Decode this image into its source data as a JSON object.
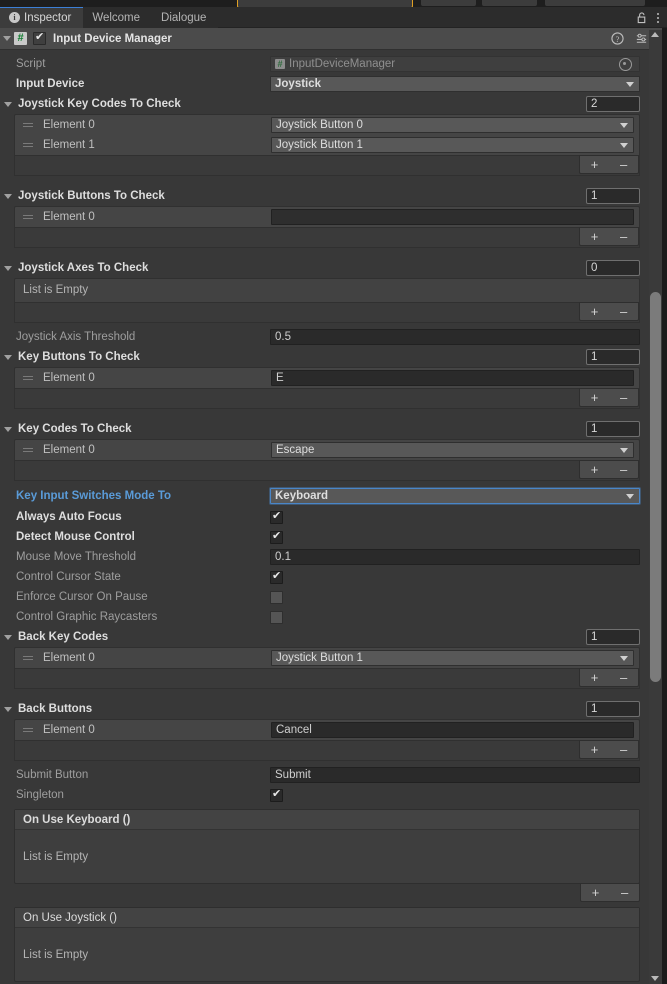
{
  "window": {
    "tabs": [
      {
        "label": "Inspector",
        "icon": "info-icon",
        "active": true
      },
      {
        "label": "Welcome",
        "icon": "",
        "active": false
      },
      {
        "label": "Dialogue",
        "icon": "",
        "active": false
      }
    ],
    "lock_icon": "lock-open-icon",
    "menu_icon": "kebab-menu-icon"
  },
  "component": {
    "enabled": true,
    "title": "Input Device Manager",
    "script_icon": "csharp-script-icon",
    "help_icon": "help-icon",
    "preset_icon": "preset-icon",
    "menu_icon": "kebab-menu-icon"
  },
  "fields": {
    "script": {
      "label": "Script",
      "value": "InputDeviceManager",
      "icon": "csharp-script-icon",
      "picker": "object-picker-icon"
    },
    "input_device": {
      "label": "Input Device",
      "value": "Joystick"
    },
    "joystick_key_codes": {
      "label": "Joystick Key Codes To Check",
      "count": "2",
      "elements": [
        {
          "label": "Element 0",
          "value": "Joystick Button 0"
        },
        {
          "label": "Element 1",
          "value": "Joystick Button 1"
        }
      ]
    },
    "joystick_buttons": {
      "label": "Joystick Buttons To Check",
      "count": "1",
      "elements": [
        {
          "label": "Element 0",
          "value": ""
        }
      ]
    },
    "joystick_axes": {
      "label": "Joystick Axes To Check",
      "count": "0",
      "empty_text": "List is Empty"
    },
    "joystick_axis_threshold": {
      "label": "Joystick Axis Threshold",
      "value": "0.5"
    },
    "key_buttons": {
      "label": "Key Buttons To Check",
      "count": "1",
      "elements": [
        {
          "label": "Element 0",
          "value": "E"
        }
      ]
    },
    "key_codes": {
      "label": "Key Codes To Check",
      "count": "1",
      "elements": [
        {
          "label": "Element 0",
          "value": "Escape"
        }
      ]
    },
    "key_input_switches_mode_to": {
      "label": "Key Input Switches Mode To",
      "value": "Keyboard"
    },
    "always_auto_focus": {
      "label": "Always Auto Focus",
      "checked": true
    },
    "detect_mouse_control": {
      "label": "Detect Mouse Control",
      "checked": true
    },
    "mouse_move_threshold": {
      "label": "Mouse Move Threshold",
      "value": "0.1"
    },
    "control_cursor_state": {
      "label": "Control Cursor State",
      "checked": true
    },
    "enforce_cursor_on_pause": {
      "label": "Enforce Cursor On Pause",
      "checked": false
    },
    "control_graphic_raycasters": {
      "label": "Control Graphic Raycasters",
      "checked": false
    },
    "back_key_codes": {
      "label": "Back Key Codes",
      "count": "1",
      "elements": [
        {
          "label": "Element 0",
          "value": "Joystick Button 1"
        }
      ]
    },
    "back_buttons": {
      "label": "Back Buttons",
      "count": "1",
      "elements": [
        {
          "label": "Element 0",
          "value": "Cancel"
        }
      ]
    },
    "submit_button": {
      "label": "Submit Button",
      "value": "Submit"
    },
    "singleton": {
      "label": "Singleton",
      "checked": true
    },
    "on_use_keyboard": {
      "label": "On Use Keyboard ()",
      "empty_text": "List is Empty"
    },
    "on_use_joystick": {
      "label": "On Use Joystick ()",
      "empty_text": "List is Empty"
    }
  },
  "buttons": {
    "add": "+",
    "remove": "–"
  },
  "colors": {
    "panel_bg": "#383838",
    "header_bg": "#4b4b4b",
    "accent_blue": "#5a9bd8",
    "focus_blue": "#4a86c8",
    "script_green": "#0f7c2f",
    "toolbar_orange": "#e0a024"
  }
}
